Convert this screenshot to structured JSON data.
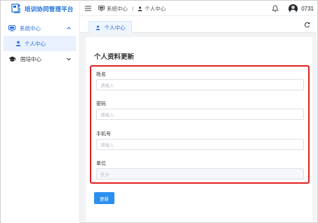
{
  "app": {
    "title": "培训协同管理平台"
  },
  "sidebar": {
    "groups": [
      {
        "label": "系统中心",
        "expanded": true,
        "items": [
          {
            "label": "个人中心",
            "active": true
          }
        ]
      },
      {
        "label": "国培中心",
        "expanded": false,
        "items": []
      }
    ]
  },
  "header": {
    "breadcrumb": [
      "系统中心",
      "个人中心"
    ],
    "breadcrumb_separator": "/",
    "user_name": "0731"
  },
  "tabs": [
    {
      "label": "个人中心",
      "active": true
    }
  ],
  "form": {
    "title": "个人资料更新",
    "fields": [
      {
        "label": "姓名",
        "value": "",
        "placeholder": "请输入",
        "disabled": false
      },
      {
        "label": "密码",
        "value": "",
        "placeholder": "请输入",
        "disabled": false
      },
      {
        "label": "手机号",
        "value": "",
        "placeholder": "请输入",
        "disabled": false
      },
      {
        "label": "单位",
        "value": "",
        "placeholder": "长沙",
        "disabled": true
      }
    ],
    "submit_label": "更新"
  },
  "icons": {
    "logo": "platform-logo-icon",
    "system_center": "monitor-icon",
    "personal_center": "user-icon",
    "national_training": "graduation-cap-icon",
    "menu": "hamburger-menu-icon",
    "bell": "bell-icon",
    "refresh": "refresh-icon"
  },
  "colors": {
    "accent": "#2a6fdb",
    "button": "#2b8ff0",
    "highlight_border": "#e02020",
    "active_bg": "#e8f1fd"
  }
}
